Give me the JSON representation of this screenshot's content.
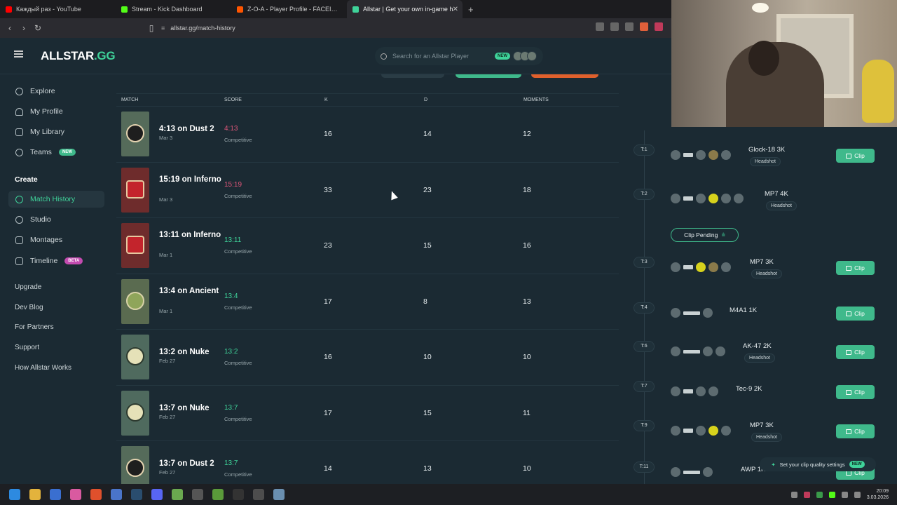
{
  "browser": {
    "tabs": [
      {
        "label": "Каждый раз - YouTube",
        "color": "#ff0000"
      },
      {
        "label": "Stream - Kick Dashboard",
        "color": "#53fc18"
      },
      {
        "label": "Z-O-A - Player Profile - FACEIT.com",
        "color": "#ff5500"
      },
      {
        "label": "Allstar | Get your own in-game h",
        "color": "#3fd39a"
      }
    ],
    "url": "allstar.gg/match-history"
  },
  "header": {
    "logo_main": "ALLSTAR",
    "logo_suffix": ".GG",
    "search_placeholder": "Search for an Allstar Player",
    "search_badge": "NEW"
  },
  "sidebar": {
    "items": [
      {
        "label": "Explore",
        "icon": "compass-icon"
      },
      {
        "label": "My Profile",
        "icon": "user-icon"
      },
      {
        "label": "My Library",
        "icon": "library-icon"
      },
      {
        "label": "Teams",
        "icon": "teams-icon",
        "badge": "NEW"
      }
    ],
    "create_heading": "Create",
    "create_items": [
      {
        "label": "Match History",
        "icon": "history-icon"
      },
      {
        "label": "Studio",
        "icon": "studio-icon"
      },
      {
        "label": "Montages",
        "icon": "montage-icon"
      },
      {
        "label": "Timeline",
        "icon": "timeline-icon",
        "badge": "BETA"
      }
    ],
    "links": [
      "Upgrade",
      "Dev Blog",
      "For Partners",
      "Support",
      "How Allstar Works"
    ]
  },
  "table": {
    "headers": {
      "match": "MATCH",
      "score": "SCORE",
      "k": "K",
      "d": "D",
      "moments": "MOMENTS"
    },
    "rows": [
      {
        "name": "4:13 on Dust 2",
        "date": "Mar 3",
        "score": "4:13",
        "result": "loss",
        "mode": "Competitive",
        "k": "16",
        "d": "14",
        "moments": "12",
        "map": "dust"
      },
      {
        "name": "15:19 on Inferno",
        "date": "Mar 3",
        "score": "15:19",
        "result": "loss",
        "mode": "Competitive",
        "k": "33",
        "d": "23",
        "moments": "18",
        "map": "inferno"
      },
      {
        "name": "13:11 on Inferno",
        "date": "Mar 1",
        "score": "13:11",
        "result": "win",
        "mode": "Competitive",
        "k": "23",
        "d": "15",
        "moments": "16",
        "map": "inferno"
      },
      {
        "name": "13:4 on Ancient",
        "date": "Mar 1",
        "score": "13:4",
        "result": "win",
        "mode": "Competitive",
        "k": "17",
        "d": "8",
        "moments": "13",
        "map": "ancient"
      },
      {
        "name": "13:2 on Nuke",
        "date": "Feb 27",
        "score": "13:2",
        "result": "win",
        "mode": "Competitive",
        "k": "16",
        "d": "10",
        "moments": "10",
        "map": "nuke"
      },
      {
        "name": "13:7 on Nuke",
        "date": "Feb 27",
        "score": "13:7",
        "result": "win",
        "mode": "Competitive",
        "k": "17",
        "d": "15",
        "moments": "11",
        "map": "nuke"
      },
      {
        "name": "13:7 on Dust 2",
        "date": "Feb 27",
        "score": "13:7",
        "result": "win",
        "mode": "Competitive",
        "k": "14",
        "d": "13",
        "moments": "10",
        "map": "dust"
      }
    ]
  },
  "moments": {
    "rounds": [
      "T:1",
      "T:2",
      "T:3",
      "T:4",
      "T:6",
      "T:7",
      "T:9",
      "T:11"
    ],
    "items": [
      {
        "title": "Glock-18 3K",
        "tag": "Headshot",
        "action": "Clip"
      },
      {
        "title": "MP7 4K",
        "tag": "Headshot",
        "action": "Clip Pending"
      },
      {
        "title": "MP7 3K",
        "tag": "Headshot",
        "action": "Clip"
      },
      {
        "title": "M4A1 1K",
        "tag": "",
        "action": "Clip"
      },
      {
        "title": "AK-47 2K",
        "tag": "Headshot",
        "action": "Clip"
      },
      {
        "title": "Tec-9 2K",
        "tag": "",
        "action": "Clip"
      },
      {
        "title": "MP7 3K",
        "tag": "Headshot",
        "action": "Clip"
      },
      {
        "title": "AWP 1K",
        "tag": "",
        "action": "Clip"
      }
    ],
    "settings_label": "Set your clip quality settings",
    "settings_badge": "NEW"
  },
  "taskbar": {
    "time": "20:09",
    "date": "3.03.2026"
  },
  "colors": {
    "accent": "#3fd39a",
    "loss": "#e0567a",
    "background": "#1b2a33"
  }
}
